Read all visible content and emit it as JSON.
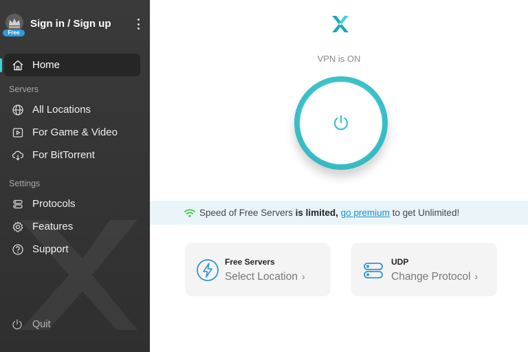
{
  "account": {
    "title": "Sign in / Sign up",
    "badge": "Free"
  },
  "sidebar": {
    "home": "Home",
    "servers_heading": "Servers",
    "servers": [
      {
        "label": "All Locations",
        "icon": "globe-icon"
      },
      {
        "label": "For Game & Video",
        "icon": "play-icon"
      },
      {
        "label": "For BitTorrent",
        "icon": "cloud-download-icon"
      }
    ],
    "settings_heading": "Settings",
    "settings": [
      {
        "label": "Protocols",
        "icon": "toggles-icon"
      },
      {
        "label": "Features",
        "icon": "gear-icon"
      },
      {
        "label": "Support",
        "icon": "help-icon"
      }
    ],
    "quit": "Quit"
  },
  "main": {
    "status": "VPN is ON",
    "banner": {
      "prefix": "Speed of Free Servers ",
      "strong": "is limited,",
      "link": "go premium",
      "suffix": " to get Unlimited!"
    },
    "cards": [
      {
        "title": "Free Servers",
        "value": "Select Location",
        "icon": "lightning-icon"
      },
      {
        "title": "UDP",
        "value": "Change Protocol",
        "icon": "toggles-icon"
      }
    ]
  },
  "colors": {
    "accent": "#3cc3cc",
    "sidebar_bg": "#333333",
    "link": "#1a8fd0",
    "badge": "#2f9be0",
    "wifi": "#3cc83c"
  }
}
